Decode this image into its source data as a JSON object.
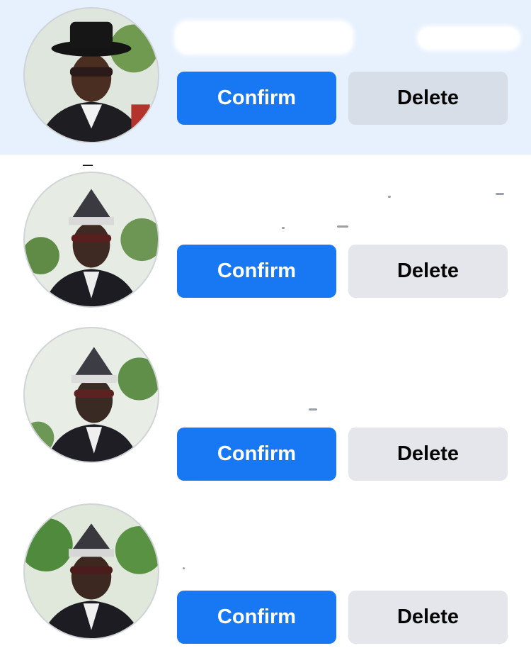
{
  "requests": [
    {
      "confirm_label": "Confirm",
      "delete_label": "Delete",
      "unread": true
    },
    {
      "confirm_label": "Confirm",
      "delete_label": "Delete",
      "unread": false
    },
    {
      "confirm_label": "Confirm",
      "delete_label": "Delete",
      "unread": false
    },
    {
      "confirm_label": "Confirm",
      "delete_label": "Delete",
      "unread": false
    }
  ],
  "colors": {
    "confirm_bg": "#1877f2",
    "delete_bg": "#e4e6eb",
    "unread_bg": "#e7f1fd"
  }
}
